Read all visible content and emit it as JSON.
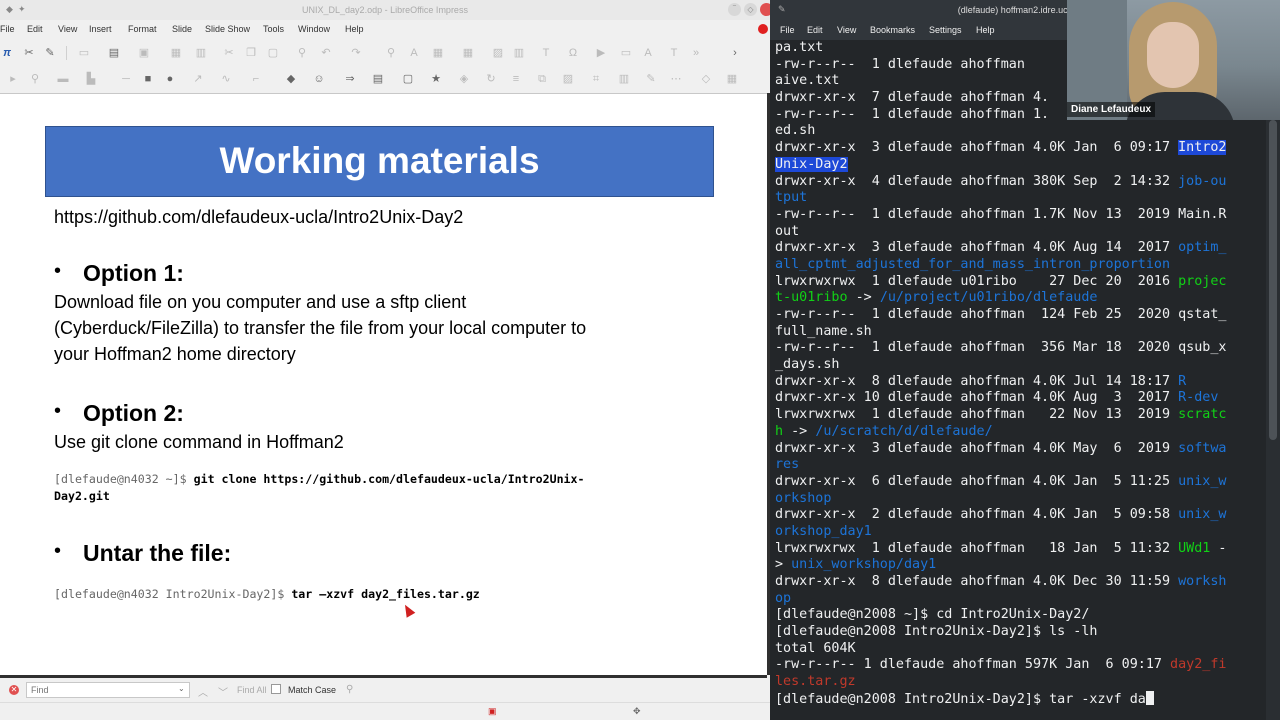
{
  "impress": {
    "window_title": "UNIX_DL_day2.odp - LibreOffice Impress",
    "menu": [
      "File",
      "Edit",
      "View",
      "Insert",
      "Format",
      "Slide",
      "Slide Show",
      "Tools",
      "Window",
      "Help"
    ],
    "slide": {
      "title": "Working materials",
      "url": "https://github.com/dlefaudeux-ucla/Intro2Unix-Day2",
      "option1_heading": "Option 1:",
      "option1_lines": [
        "Download file on you computer and use a sftp client",
        "(Cyberduck/FileZilla) to transfer the file from your local computer to",
        "your Hoffman2 home directory"
      ],
      "option2_heading": "Option 2:",
      "option2_text": "Use git clone command in Hoffman2",
      "git_prompt": "[dlefaude@n4032 ~]$",
      "git_cmd_line1": " git clone https://github.com/dlefaudeux-ucla/Intro2Unix-",
      "git_cmd_line2": "Day2.git",
      "untar_heading": "Untar the file:",
      "tar_prompt": "[dlefaude@n4032 Intro2Unix-Day2]$",
      "tar_cmd": " tar –xzvf day2_files.tar.gz",
      "bullet": "•"
    },
    "findbar": {
      "placeholder": "Find",
      "find_all": "Find All",
      "match_case": "Match Case"
    }
  },
  "terminal": {
    "window_title": "(dlefaude) hoffman2.idre.ucla.edu",
    "menu": [
      "File",
      "Edit",
      "View",
      "Bookmarks",
      "Settings",
      "Help"
    ],
    "lines": [
      [
        {
          "t": "pa.txt"
        }
      ],
      [
        {
          "t": "-rw-r--r--  1 dlefaude ahoffman"
        }
      ],
      [
        {
          "t": "aive.txt"
        }
      ],
      [
        {
          "t": "drwxr-xr-x  7 dlefaude ahoffman 4."
        }
      ],
      [
        {
          "t": "-rw-r--r--  1 dlefaude ahoffman 1."
        }
      ],
      [
        {
          "t": "ed.sh"
        }
      ],
      [
        {
          "t": "drwxr-xr-x  3 dlefaude ahoffman 4.0K Jan  6 09:17 "
        },
        {
          "t": "Intro2",
          "c": "sel"
        }
      ],
      [
        {
          "t": "Unix-Day2",
          "c": "sel"
        }
      ],
      [
        {
          "t": "drwxr-xr-x  4 dlefaude ahoffman 380K Sep  2 14:32 "
        },
        {
          "t": "job-ou",
          "c": "blue"
        }
      ],
      [
        {
          "t": "tput",
          "c": "blue"
        }
      ],
      [
        {
          "t": "-rw-r--r--  1 dlefaude ahoffman 1.7K Nov 13  2019 Main.R"
        }
      ],
      [
        {
          "t": "out"
        }
      ],
      [
        {
          "t": "drwxr-xr-x  3 dlefaude ahoffman 4.0K Aug 14  2017 "
        },
        {
          "t": "optim_",
          "c": "blue"
        }
      ],
      [
        {
          "t": "all_cptmt_adjusted_for_and_mass_intron_proportion",
          "c": "blue"
        }
      ],
      [
        {
          "t": "lrwxrwxrwx  1 dlefaude u01ribo    27 Dec 20  2016 "
        },
        {
          "t": "projec",
          "c": "green"
        }
      ],
      [
        {
          "t": "t-u01ribo",
          "c": "green"
        },
        {
          "t": " -> "
        },
        {
          "t": "/u/project/u01ribo/dlefaude",
          "c": "blue"
        }
      ],
      [
        {
          "t": "-rw-r--r--  1 dlefaude ahoffman  124 Feb 25  2020 qstat_"
        }
      ],
      [
        {
          "t": "full_name.sh"
        }
      ],
      [
        {
          "t": "-rw-r--r--  1 dlefaude ahoffman  356 Mar 18  2020 qsub_x"
        }
      ],
      [
        {
          "t": "_days.sh"
        }
      ],
      [
        {
          "t": "drwxr-xr-x  8 dlefaude ahoffman 4.0K Jul 14 18:17 "
        },
        {
          "t": "R",
          "c": "blue"
        }
      ],
      [
        {
          "t": "drwxr-xr-x 10 dlefaude ahoffman 4.0K Aug  3  2017 "
        },
        {
          "t": "R-dev",
          "c": "blue"
        }
      ],
      [
        {
          "t": "lrwxrwxrwx  1 dlefaude ahoffman   22 Nov 13  2019 "
        },
        {
          "t": "scratc",
          "c": "green"
        }
      ],
      [
        {
          "t": "h",
          "c": "green"
        },
        {
          "t": " -> "
        },
        {
          "t": "/u/scratch/d/dlefaude/",
          "c": "blue"
        }
      ],
      [
        {
          "t": "drwxr-xr-x  3 dlefaude ahoffman 4.0K May  6  2019 "
        },
        {
          "t": "softwa",
          "c": "blue"
        }
      ],
      [
        {
          "t": "res",
          "c": "blue"
        }
      ],
      [
        {
          "t": "drwxr-xr-x  6 dlefaude ahoffman 4.0K Jan  5 11:25 "
        },
        {
          "t": "unix_w",
          "c": "blue"
        }
      ],
      [
        {
          "t": "orkshop",
          "c": "blue"
        }
      ],
      [
        {
          "t": "drwxr-xr-x  2 dlefaude ahoffman 4.0K Jan  5 09:58 "
        },
        {
          "t": "unix_w",
          "c": "blue"
        }
      ],
      [
        {
          "t": "orkshop_day1",
          "c": "blue"
        }
      ],
      [
        {
          "t": "lrwxrwxrwx  1 dlefaude ahoffman   18 Jan  5 11:32 "
        },
        {
          "t": "UWd1",
          "c": "green"
        },
        {
          "t": " -"
        }
      ],
      [
        {
          "t": "> "
        },
        {
          "t": "unix_workshop/day1",
          "c": "blue"
        }
      ],
      [
        {
          "t": "drwxr-xr-x  8 dlefaude ahoffman 4.0K Dec 30 11:59 "
        },
        {
          "t": "worksh",
          "c": "blue"
        }
      ],
      [
        {
          "t": "op",
          "c": "blue"
        }
      ],
      [
        {
          "t": "[dlefaude@n2008 ~]$ cd Intro2Unix-Day2/"
        }
      ],
      [
        {
          "t": "[dlefaude@n2008 Intro2Unix-Day2]$ ls -lh"
        }
      ],
      [
        {
          "t": "total 604K"
        }
      ],
      [
        {
          "t": "-rw-r--r-- 1 dlefaude ahoffman 597K Jan  6 09:17 "
        },
        {
          "t": "day2_fi",
          "c": "red"
        }
      ],
      [
        {
          "t": "les.tar.gz",
          "c": "red"
        }
      ],
      [
        {
          "t": "[dlefaude@n2008 Intro2Unix-Day2]$ tar -xzvf da"
        },
        {
          "t": "",
          "c": "cursor"
        }
      ]
    ]
  },
  "webcam": {
    "participant_name": "Diane Lefaudeux"
  }
}
